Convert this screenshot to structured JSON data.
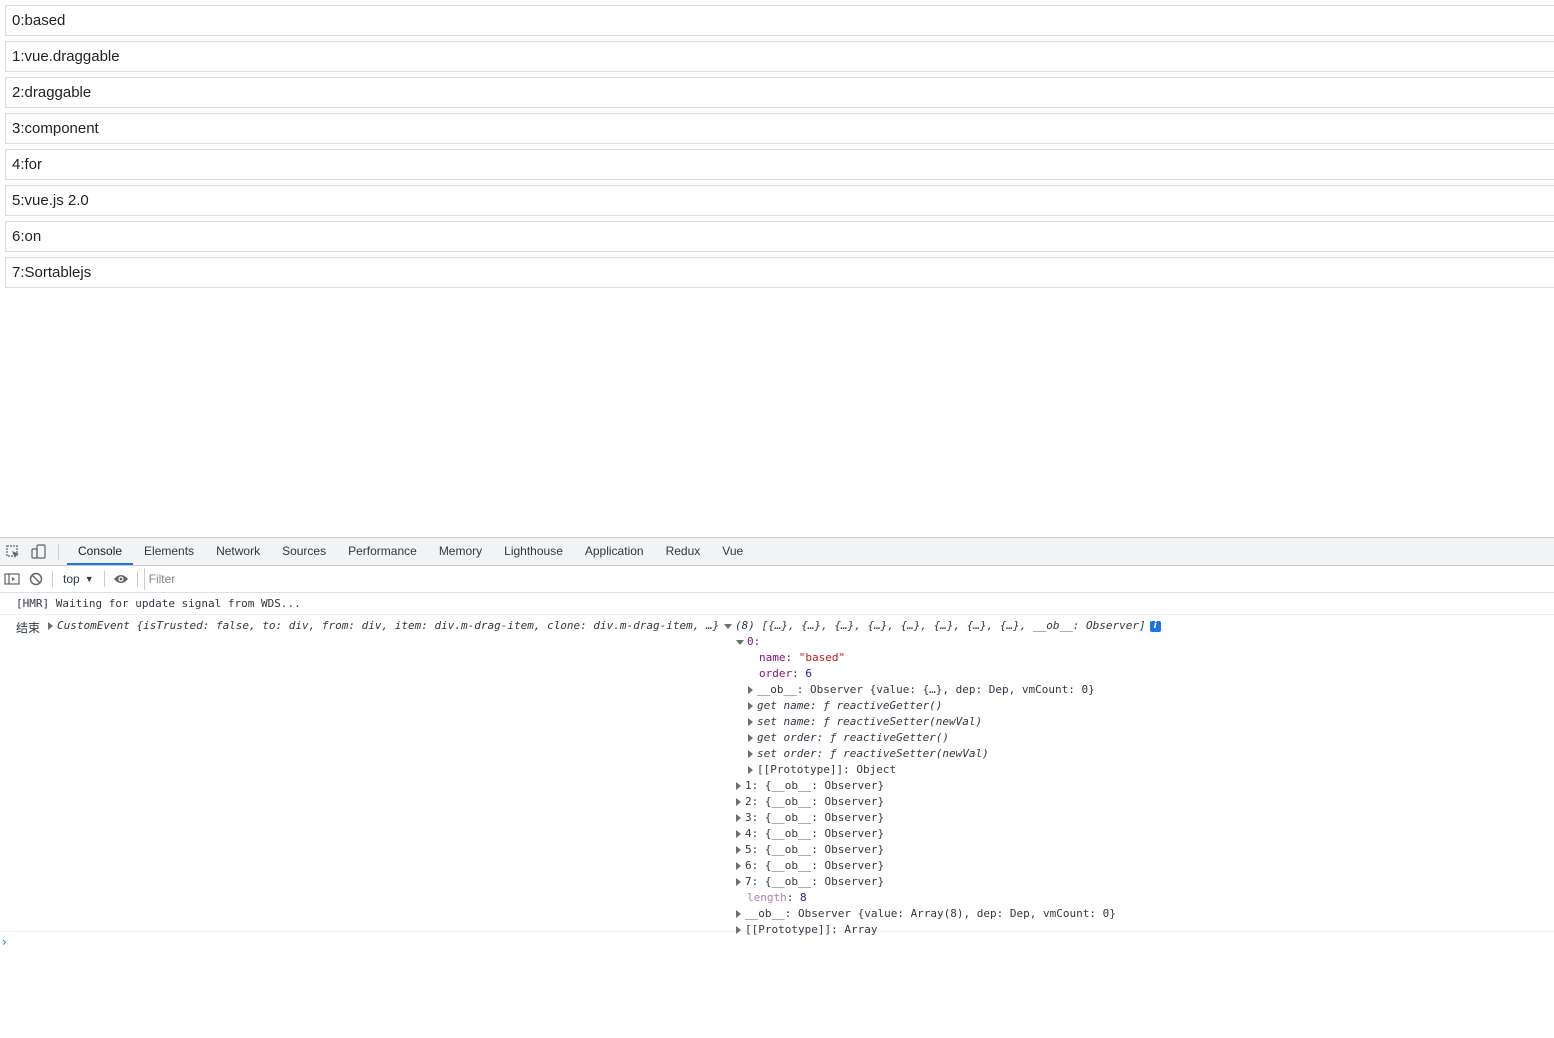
{
  "drag_items": [
    "0:based",
    "1:vue.draggable",
    "2:draggable",
    "3:component",
    "4:for",
    "5:vue.js 2.0",
    "6:on",
    "7:Sortablejs"
  ],
  "devtools": {
    "tabs": [
      "Console",
      "Elements",
      "Network",
      "Sources",
      "Performance",
      "Memory",
      "Lighthouse",
      "Application",
      "Redux",
      "Vue"
    ],
    "active_tab": "Console",
    "context": "top",
    "filter_placeholder": "Filter"
  },
  "console": {
    "hmr": "[HMR] Waiting for update signal from WDS...",
    "end_label": "结束",
    "event_summary": "CustomEvent {isTrusted: false, to: div, from: div, item: div.m-drag-item, clone: div.m-drag-item, …}",
    "array_summary": "(8) [{…}, {…}, {…}, {…}, {…}, {…}, {…}, {…}, __ob__: Observer]",
    "info_badge": "i",
    "item0": {
      "index": "0:",
      "name_key": "name",
      "name_val": "\"based\"",
      "order_key": "order",
      "order_val": "6",
      "ob_line": "__ob__: Observer {value: {…}, dep: Dep, vmCount: 0}",
      "get_name": "get name: ƒ reactiveGetter()",
      "set_name": "set name: ƒ reactiveSetter(newVal)",
      "get_order": "get order: ƒ reactiveGetter()",
      "set_order": "set order: ƒ reactiveSetter(newVal)",
      "proto": "[[Prototype]]: Object"
    },
    "collapsed_items": [
      "1: {__ob__: Observer}",
      "2: {__ob__: Observer}",
      "3: {__ob__: Observer}",
      "4: {__ob__: Observer}",
      "5: {__ob__: Observer}",
      "6: {__ob__: Observer}",
      "7: {__ob__: Observer}"
    ],
    "length_key": "length",
    "length_val": "8",
    "array_ob": "__ob__: Observer {value: Array(8), dep: Dep, vmCount: 0}",
    "array_proto": "[[Prototype]]: Array",
    "prompt": "›"
  },
  "colors": {
    "accent": "#1a73e8",
    "key": "#881280",
    "string": "#c41a16",
    "number": "#1a1aa6"
  }
}
